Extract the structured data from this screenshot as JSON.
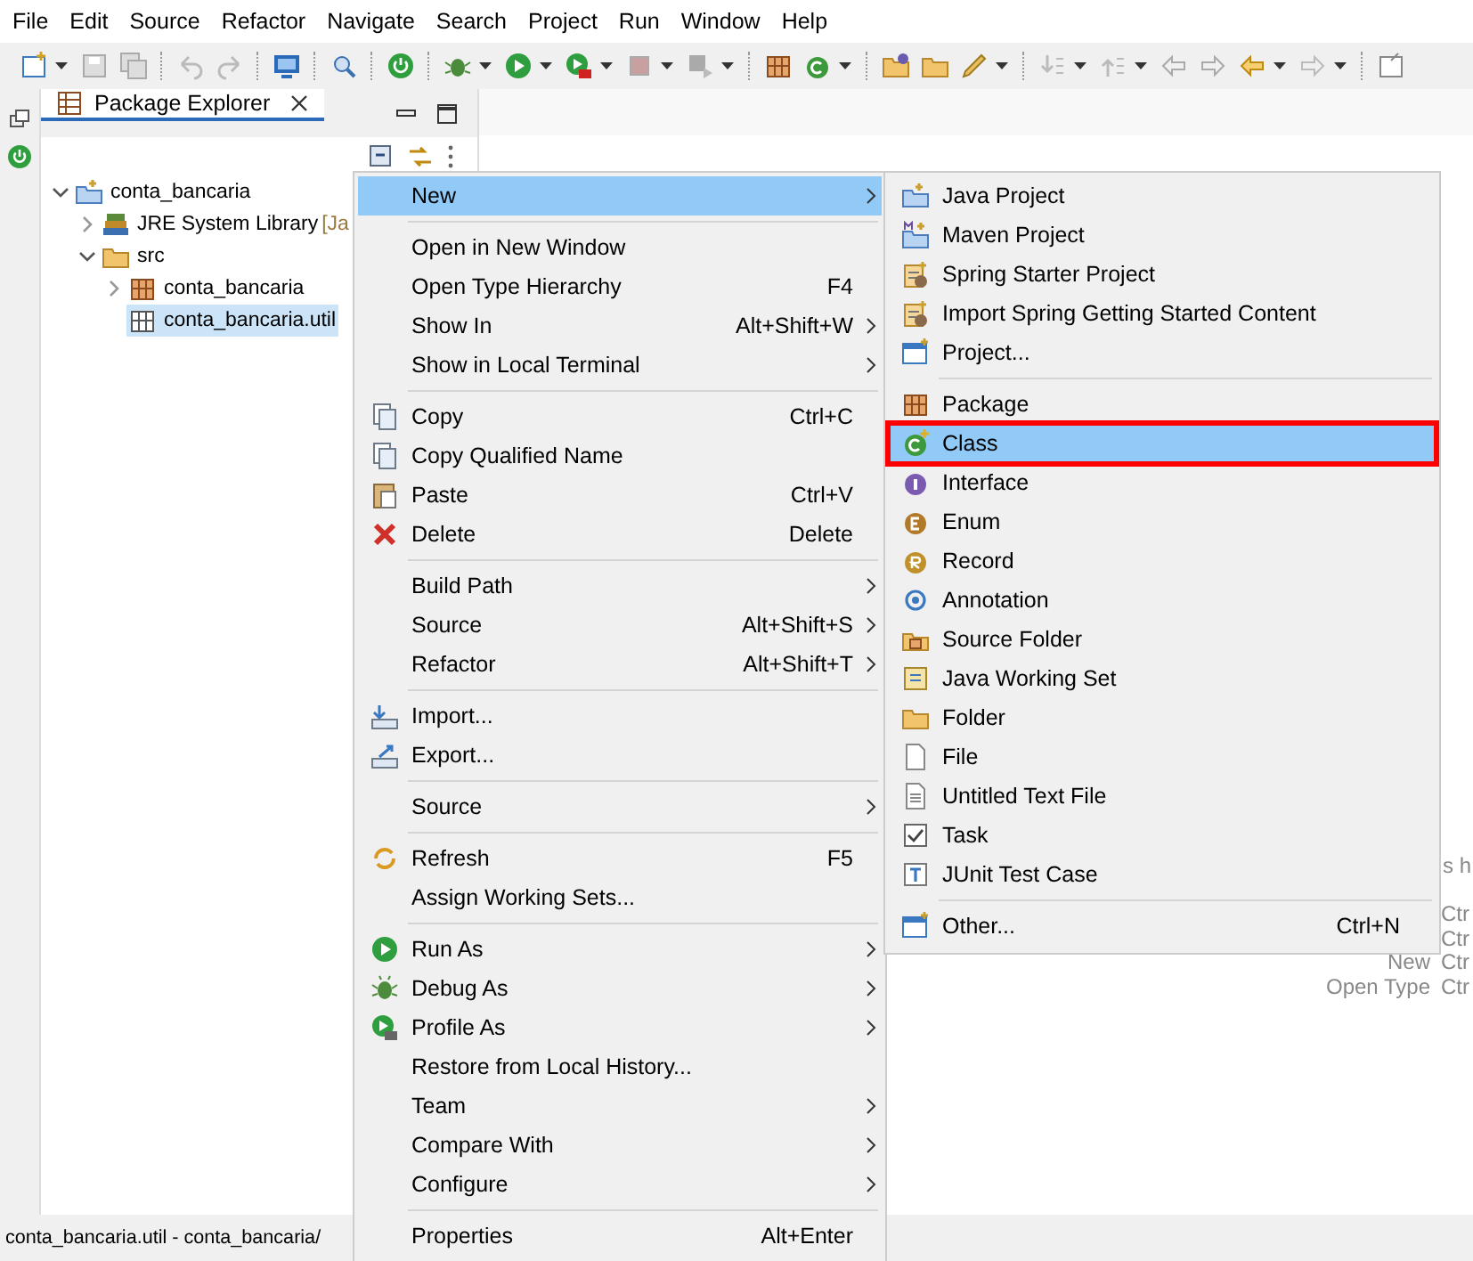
{
  "menu_bar": [
    "File",
    "Edit",
    "Source",
    "Refactor",
    "Navigate",
    "Search",
    "Project",
    "Run",
    "Window",
    "Help"
  ],
  "package_explorer": {
    "title": "Package Explorer",
    "selected": true,
    "tree": [
      {
        "label": "conta_bancaria",
        "expanded": true,
        "selected": false,
        "children": [
          {
            "label": "JRE System Library",
            "decoration": "[Ja",
            "expanded": false,
            "selected": false
          },
          {
            "label": "src",
            "expanded": true,
            "selected": false,
            "children": [
              {
                "label": "conta_bancaria",
                "expanded": false,
                "selected": false
              },
              {
                "label": "conta_bancaria.util",
                "selected": true
              }
            ]
          }
        ]
      }
    ]
  },
  "editor_hints": {
    "heading": "s h",
    "rows": [
      {
        "key": "Ctr"
      },
      {
        "key": "Ctr"
      },
      {
        "label": "New",
        "key": "Ctr"
      },
      {
        "label": "Open Type",
        "key": "Ctr"
      }
    ]
  },
  "context_menu": {
    "groups": [
      [
        {
          "label": "New",
          "submenu": true,
          "selected": true
        }
      ],
      [
        {
          "label": "Open in New Window",
          "submenu": false,
          "selected": false
        },
        {
          "label": "Open Type Hierarchy",
          "shortcut": "F4",
          "submenu": false,
          "selected": false
        },
        {
          "label": "Show In",
          "shortcut": "Alt+Shift+W",
          "submenu": true,
          "selected": false
        },
        {
          "label": "Show in Local Terminal",
          "submenu": true,
          "selected": false
        }
      ],
      [
        {
          "label": "Copy",
          "shortcut": "Ctrl+C",
          "submenu": false,
          "selected": false
        },
        {
          "label": "Copy Qualified Name",
          "submenu": false,
          "selected": false
        },
        {
          "label": "Paste",
          "shortcut": "Ctrl+V",
          "submenu": false,
          "selected": false
        },
        {
          "label": "Delete",
          "shortcut": "Delete",
          "submenu": false,
          "selected": false
        }
      ],
      [
        {
          "label": "Build Path",
          "submenu": true,
          "selected": false
        },
        {
          "label": "Source",
          "shortcut": "Alt+Shift+S",
          "submenu": true,
          "selected": false
        },
        {
          "label": "Refactor",
          "shortcut": "Alt+Shift+T",
          "submenu": true,
          "selected": false
        }
      ],
      [
        {
          "label": "Import...",
          "submenu": false,
          "selected": false
        },
        {
          "label": "Export...",
          "submenu": false,
          "selected": false
        }
      ],
      [
        {
          "label": "Source",
          "submenu": true,
          "selected": false
        }
      ],
      [
        {
          "label": "Refresh",
          "shortcut": "F5",
          "submenu": false,
          "selected": false
        },
        {
          "label": "Assign Working Sets...",
          "submenu": false,
          "selected": false
        }
      ],
      [
        {
          "label": "Run As",
          "submenu": true,
          "selected": false
        },
        {
          "label": "Debug As",
          "submenu": true,
          "selected": false
        },
        {
          "label": "Profile As",
          "submenu": true,
          "selected": false
        },
        {
          "label": "Restore from Local History...",
          "submenu": false,
          "selected": false
        },
        {
          "label": "Team",
          "submenu": true,
          "selected": false
        },
        {
          "label": "Compare With",
          "submenu": true,
          "selected": false
        },
        {
          "label": "Configure",
          "submenu": true,
          "selected": false
        }
      ],
      [
        {
          "label": "Properties",
          "shortcut": "Alt+Enter",
          "submenu": false,
          "selected": false
        }
      ]
    ]
  },
  "new_submenu": {
    "groups": [
      [
        {
          "label": "Java Project",
          "selected": false,
          "outlined": false
        },
        {
          "label": "Maven Project",
          "selected": false,
          "outlined": false
        },
        {
          "label": "Spring Starter Project",
          "selected": false,
          "outlined": false
        },
        {
          "label": "Import Spring Getting Started Content",
          "selected": false,
          "outlined": false
        },
        {
          "label": "Project...",
          "selected": false,
          "outlined": false
        }
      ],
      [
        {
          "label": "Package",
          "selected": false,
          "outlined": false
        },
        {
          "label": "Class",
          "selected": true,
          "outlined": true
        },
        {
          "label": "Interface",
          "selected": false,
          "outlined": false
        },
        {
          "label": "Enum",
          "selected": false,
          "outlined": false
        },
        {
          "label": "Record",
          "selected": false,
          "outlined": false
        },
        {
          "label": "Annotation",
          "selected": false,
          "outlined": false
        },
        {
          "label": "Source Folder",
          "selected": false,
          "outlined": false
        },
        {
          "label": "Java Working Set",
          "selected": false,
          "outlined": false
        },
        {
          "label": "Folder",
          "selected": false,
          "outlined": false
        },
        {
          "label": "File",
          "selected": false,
          "outlined": false
        },
        {
          "label": "Untitled Text File",
          "selected": false,
          "outlined": false
        },
        {
          "label": "Task",
          "selected": false,
          "outlined": false
        },
        {
          "label": "JUnit Test Case",
          "selected": false,
          "outlined": false
        }
      ],
      [
        {
          "label": "Other...",
          "shortcut": "Ctrl+N",
          "selected": false,
          "outlined": false
        }
      ]
    ]
  },
  "status_bar": {
    "text": "conta_bancaria.util - conta_bancaria/"
  }
}
